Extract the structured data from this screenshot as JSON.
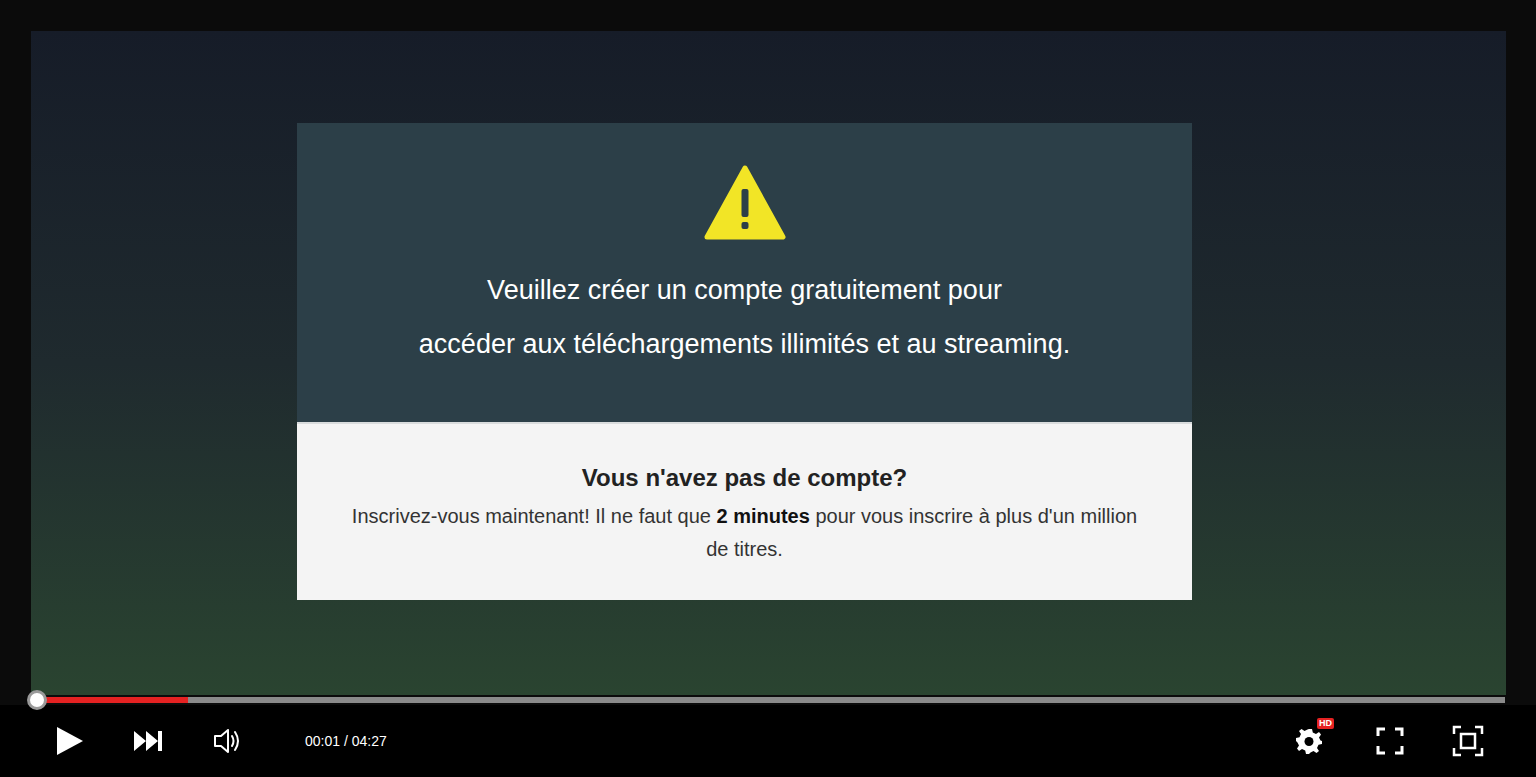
{
  "modal": {
    "title_lines": [
      "Veuillez créer un compte gratuitement pour",
      "accéder aux téléchargements illimités et au streaming."
    ],
    "subheading": "Vous n'avez pas de compte?",
    "body": [
      {
        "text": "Inscrivez-vous maintenant! Il ne faut que ",
        "bold": false
      },
      {
        "text": "2 minutes",
        "bold": true
      },
      {
        "text": " pour vous inscrire à plus d'un million de titres.",
        "bold": false
      }
    ]
  },
  "player": {
    "progress": {
      "level": 0.103
    },
    "time": "00:01 / 04:27",
    "quality_badge": "HD"
  }
}
